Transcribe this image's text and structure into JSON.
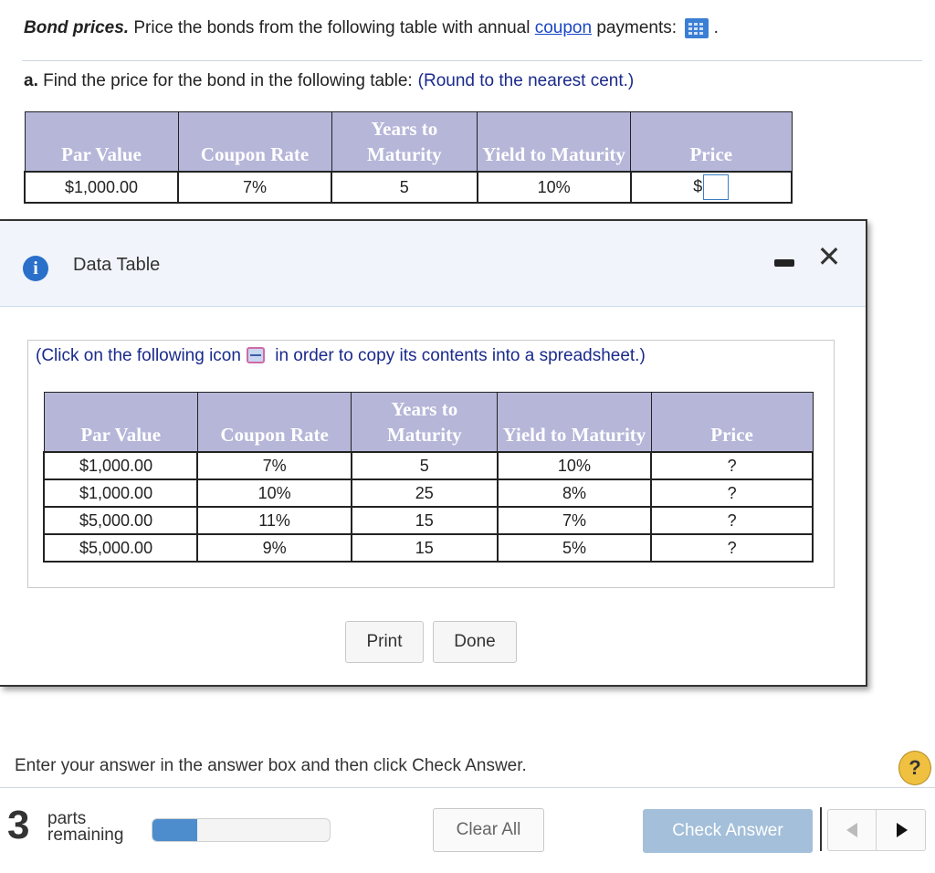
{
  "question": {
    "title_bold": "Bond prices.",
    "title_text": " Price the bonds from the following table with annual ",
    "title_link": "coupon",
    "title_after": " payments:",
    "title_end": ".",
    "data_icon": "data-table-grid-icon"
  },
  "part_a": {
    "label": "a.",
    "text": " Find the price for the bond in the following table:",
    "hint": "(Round to the nearest cent.)"
  },
  "main_table": {
    "headers": [
      "Par Value",
      "Coupon Rate",
      "Years to Maturity",
      "Yield to Maturity",
      "Price"
    ],
    "row": {
      "par_value": "$1,000.00",
      "coupon_rate": "7%",
      "years": "5",
      "yield": "10%",
      "price_prefix": "$",
      "price_value": ""
    }
  },
  "dialog": {
    "title": "Data Table",
    "copy_note_before": "(Click on the following icon",
    "copy_note_after": " in order to copy its contents into a spreadsheet.)",
    "table": {
      "headers": [
        "Par Value",
        "Coupon Rate",
        "Years to Maturity",
        "Yield to Maturity",
        "Price"
      ],
      "rows": [
        [
          "$1,000.00",
          "7%",
          "5",
          "10%",
          "?"
        ],
        [
          "$1,000.00",
          "10%",
          "25",
          "8%",
          "?"
        ],
        [
          "$5,000.00",
          "11%",
          "15",
          "7%",
          "?"
        ],
        [
          "$5,000.00",
          "9%",
          "15",
          "5%",
          "?"
        ]
      ]
    },
    "print_label": "Print",
    "done_label": "Done"
  },
  "footer": {
    "instruction": "Enter your answer in the answer box and then click Check Answer.",
    "help": "?",
    "parts_count": "3",
    "parts_line1": "parts",
    "parts_line2": "remaining",
    "progress_fraction": 0.25,
    "clear_all": "Clear All",
    "check_answer": "Check Answer"
  },
  "colors": {
    "header_bg": "#b5b6d8",
    "link": "#1a47c4",
    "hint": "#1a2a8c",
    "progress": "#4d8ccd",
    "check_button": "#a3bfd9"
  }
}
